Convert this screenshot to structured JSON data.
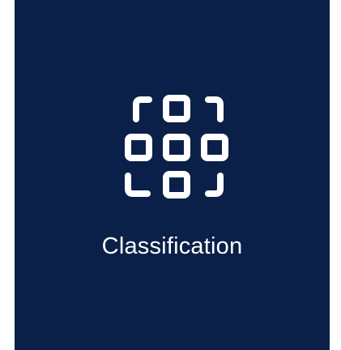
{
  "tile": {
    "label": "Classification",
    "icon": "classification-grid-icon",
    "background_color": "#0b2049",
    "foreground_color": "#ffffff"
  }
}
